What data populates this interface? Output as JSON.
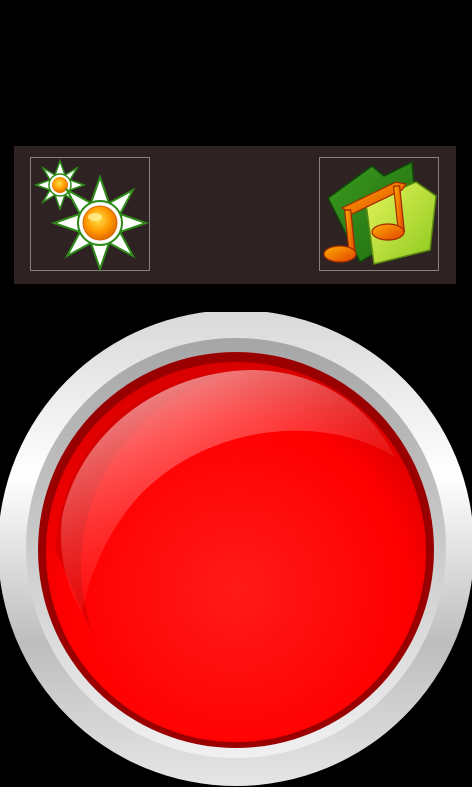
{
  "colors": {
    "background": "#000000",
    "toolbar_bg": "#2e2223",
    "button_red": "#ff0000",
    "ring_silver": "#c8c8c8"
  },
  "toolbar": {
    "settings_icon": "sun-settings-icon",
    "music_icon": "music-folder-icon"
  },
  "main": {
    "big_button_icon": "red-push-button"
  }
}
